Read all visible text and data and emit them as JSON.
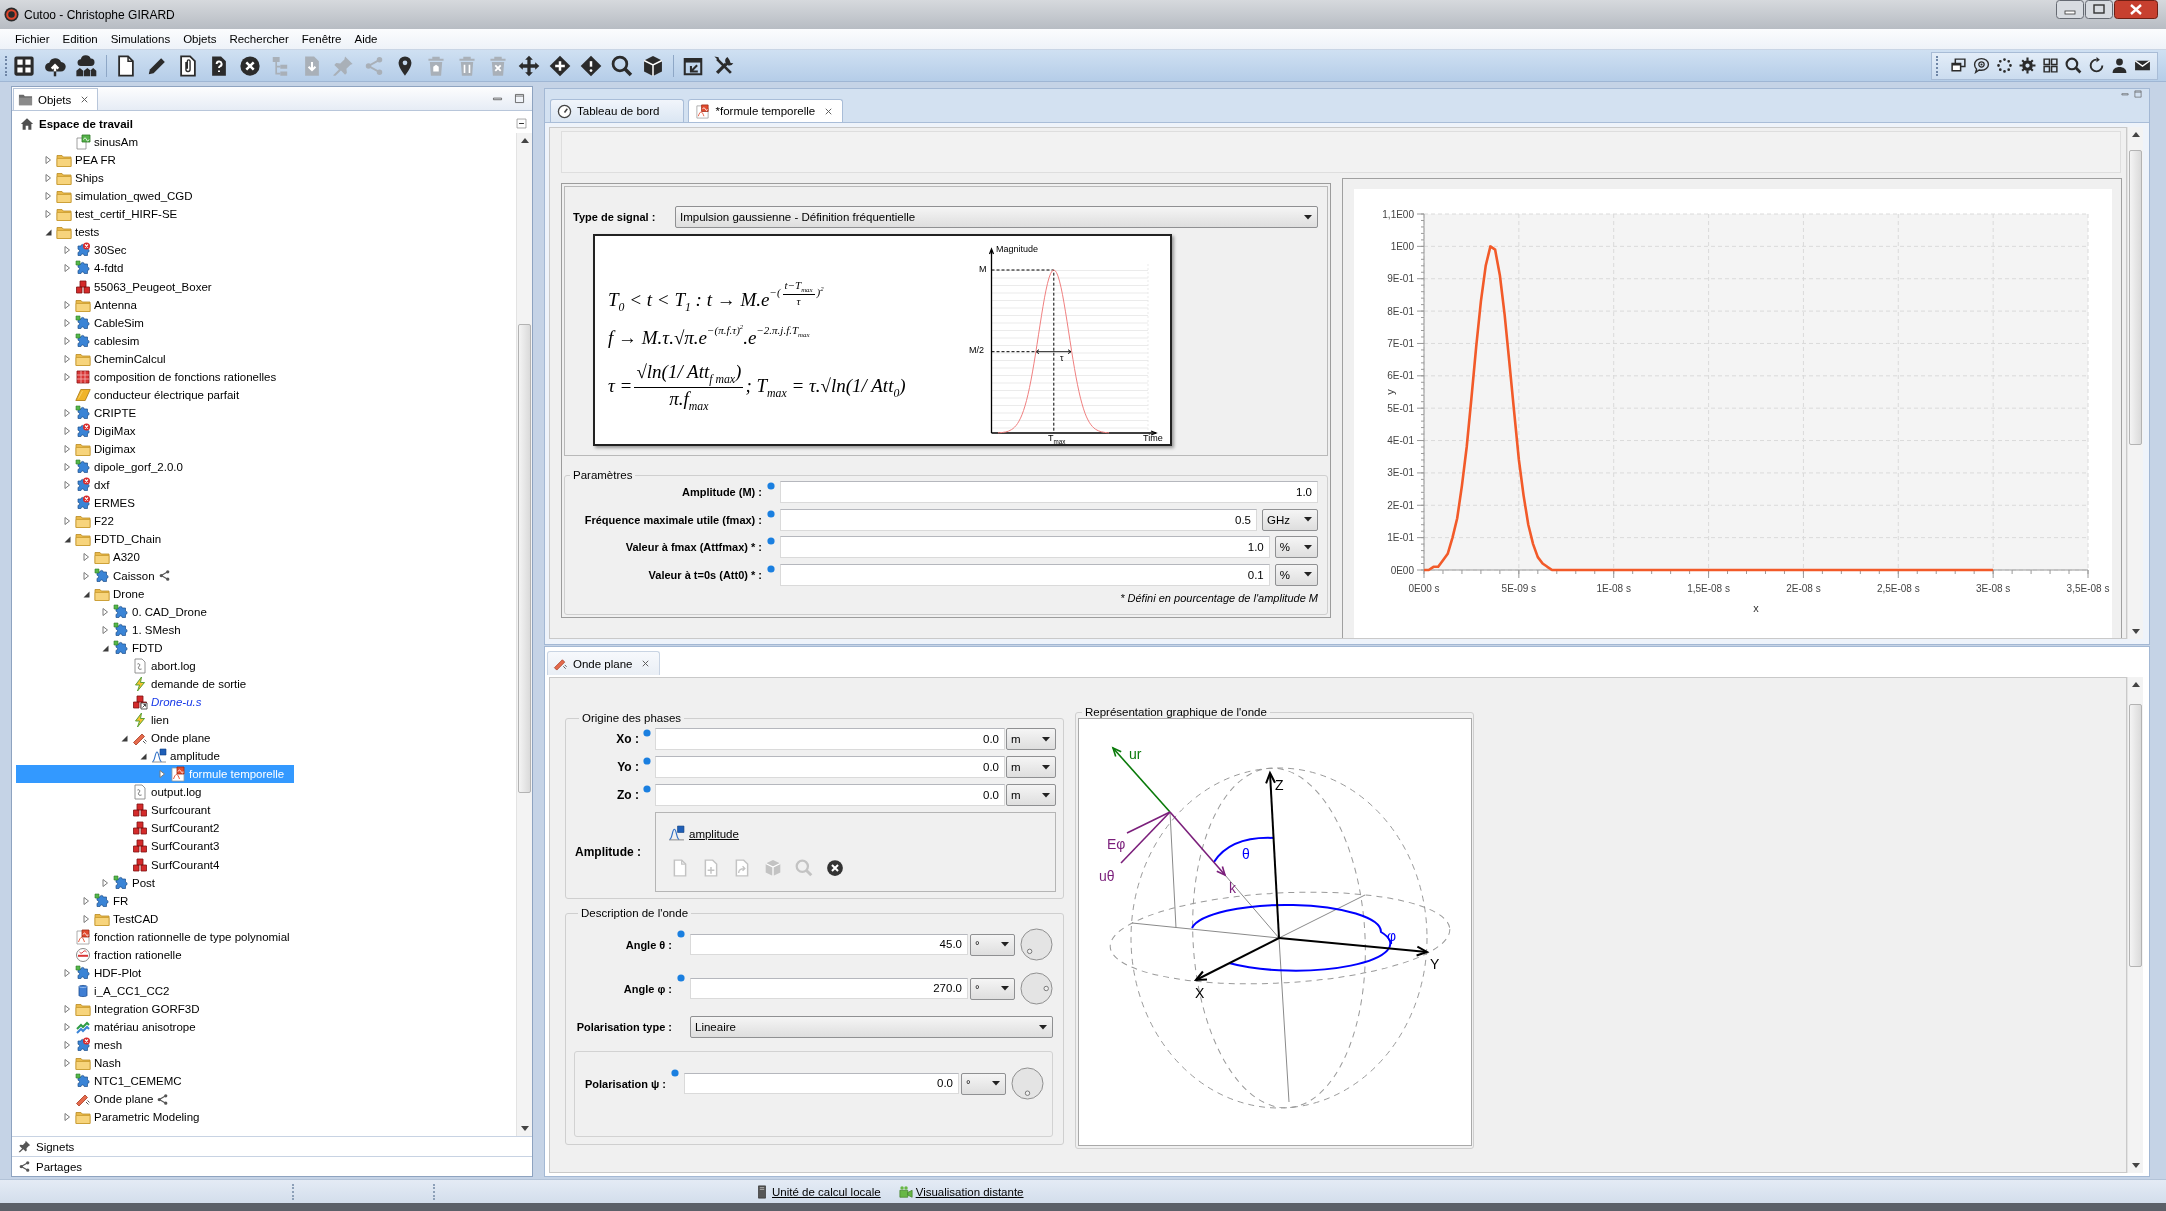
{
  "window": {
    "title": "Cutoo - Christophe GIRARD"
  },
  "menu": [
    "Fichier",
    "Edition",
    "Simulations",
    "Objets",
    "Rechercher",
    "Fenêtre",
    "Aide"
  ],
  "toolbar": {
    "groups": [
      [
        {
          "kind": "grid",
          "disabled": false
        },
        {
          "kind": "cloudup",
          "disabled": false
        },
        {
          "kind": "cloudhouse",
          "disabled": false
        }
      ],
      [
        {
          "kind": "doc",
          "disabled": false
        },
        {
          "kind": "pencil",
          "disabled": false
        },
        {
          "kind": "attach",
          "disabled": false
        },
        {
          "kind": "help",
          "disabled": false
        },
        {
          "kind": "closecircle",
          "disabled": false
        },
        {
          "kind": "tree",
          "disabled": true
        },
        {
          "kind": "import",
          "disabled": true
        },
        {
          "kind": "pin",
          "disabled": true
        },
        {
          "kind": "share",
          "disabled": true
        },
        {
          "kind": "marker",
          "disabled": false
        },
        {
          "kind": "trashbox",
          "disabled": true
        },
        {
          "kind": "trash",
          "disabled": true
        },
        {
          "kind": "trashx",
          "disabled": true
        },
        {
          "kind": "move",
          "disabled": false
        },
        {
          "kind": "plusdiamond",
          "disabled": false
        },
        {
          "kind": "tagdiamond",
          "disabled": false
        },
        {
          "kind": "search",
          "disabled": false
        },
        {
          "kind": "cube",
          "disabled": false
        }
      ],
      [
        {
          "kind": "winback",
          "disabled": false
        },
        {
          "kind": "tools",
          "disabled": false
        }
      ]
    ]
  },
  "objects": {
    "tab": "Objets",
    "root": "Espace de travail",
    "hidden_parent_children": [
      {
        "label": "sinusAm",
        "kind": "script",
        "selected": false
      }
    ],
    "items": [
      {
        "label": "PEA FR",
        "kind": "folder",
        "expanded": false,
        "selected": false
      },
      {
        "label": "Ships",
        "kind": "folder",
        "expanded": false,
        "selected": false
      },
      {
        "label": "simulation_qwed_CGD",
        "kind": "folder",
        "expanded": false,
        "selected": false
      },
      {
        "label": "test_certif_HIRF-SE",
        "kind": "folder",
        "expanded": false,
        "selected": false
      },
      {
        "label": "tests",
        "kind": "folder",
        "expanded": true,
        "selected": false,
        "children": [
          {
            "label": "30Sec",
            "kind": "simerror",
            "expanded": false,
            "selected": false
          },
          {
            "label": "4-fdtd",
            "kind": "sim",
            "expanded": false,
            "selected": false
          },
          {
            "label": "55063_Peugeot_Boxer",
            "kind": "part",
            "selected": false
          },
          {
            "label": "Antenna",
            "kind": "folder",
            "expanded": false,
            "selected": false
          },
          {
            "label": "CableSim",
            "kind": "sim",
            "expanded": false,
            "selected": false
          },
          {
            "label": "cablesim",
            "kind": "sim",
            "expanded": false,
            "selected": false
          },
          {
            "label": "CheminCalcul",
            "kind": "folder",
            "expanded": false,
            "selected": false
          },
          {
            "label": "composition de fonctions rationelles",
            "kind": "table",
            "expanded": false,
            "selected": false
          },
          {
            "label": "conducteur électrique parfait",
            "kind": "plate",
            "selected": false
          },
          {
            "label": "CRIPTE",
            "kind": "sim",
            "expanded": false,
            "selected": false
          },
          {
            "label": "DigiMax",
            "kind": "simerror",
            "expanded": false,
            "selected": false
          },
          {
            "label": "Digimax",
            "kind": "folder",
            "expanded": false,
            "selected": false
          },
          {
            "label": "dipole_gorf_2.0.0",
            "kind": "sim",
            "expanded": false,
            "selected": false
          },
          {
            "label": "dxf",
            "kind": "simerror",
            "expanded": false,
            "selected": false
          },
          {
            "label": "ERMES",
            "kind": "simerror",
            "selected": false
          },
          {
            "label": "F22",
            "kind": "folder",
            "expanded": false,
            "selected": false
          },
          {
            "label": "FDTD_Chain",
            "kind": "folder",
            "expanded": true,
            "selected": false,
            "children": [
              {
                "label": "A320",
                "kind": "folder",
                "expanded": false,
                "selected": false
              },
              {
                "label": "Caisson",
                "kind": "sim",
                "expanded": false,
                "selected": false,
                "shared": true
              },
              {
                "label": "Drone",
                "kind": "folder",
                "expanded": true,
                "selected": false,
                "children": [
                  {
                    "label": "0. CAD_Drone",
                    "kind": "sim",
                    "expanded": false,
                    "selected": false
                  },
                  {
                    "label": "1. SMesh",
                    "kind": "sim",
                    "expanded": false,
                    "selected": false
                  },
                  {
                    "label": "FDTD",
                    "kind": "sim",
                    "expanded": true,
                    "selected": false,
                    "children": [
                      {
                        "label": "abort.log",
                        "kind": "log",
                        "selected": false
                      },
                      {
                        "label": "demande de sortie",
                        "kind": "link",
                        "selected": false
                      },
                      {
                        "label": "Drone-u.s",
                        "kind": "partlink",
                        "selected": false
                      },
                      {
                        "label": "lien",
                        "kind": "link",
                        "selected": false
                      },
                      {
                        "label": "Onde plane",
                        "kind": "wave",
                        "expanded": true,
                        "selected": false,
                        "children": [
                          {
                            "label": "amplitude",
                            "kind": "signal",
                            "expanded": true,
                            "selected": false,
                            "children": [
                              {
                                "label": "formule temporelle",
                                "kind": "formula",
                                "expanded": false,
                                "selected": true
                              }
                            ]
                          }
                        ]
                      },
                      {
                        "label": "output.log",
                        "kind": "log",
                        "selected": false
                      },
                      {
                        "label": "Surfcourant",
                        "kind": "part",
                        "selected": false
                      },
                      {
                        "label": "SurfCourant2",
                        "kind": "part",
                        "selected": false
                      },
                      {
                        "label": "SurfCourant3",
                        "kind": "part",
                        "selected": false
                      },
                      {
                        "label": "SurfCourant4",
                        "kind": "part",
                        "selected": false
                      }
                    ]
                  },
                  {
                    "label": "Post",
                    "kind": "sim",
                    "expanded": false,
                    "selected": false
                  }
                ]
              },
              {
                "label": "FR",
                "kind": "sim",
                "expanded": false,
                "selected": false
              },
              {
                "label": "TestCAD",
                "kind": "folder",
                "expanded": false,
                "selected": false
              }
            ]
          },
          {
            "label": "fonction rationnelle de type polynomial",
            "kind": "formula",
            "selected": false
          },
          {
            "label": "fraction rationelle",
            "kind": "fraction",
            "selected": false
          },
          {
            "label": "HDF-Plot",
            "kind": "sim",
            "expanded": false,
            "selected": false
          },
          {
            "label": "i_A_CC1_CC2",
            "kind": "cylinder",
            "selected": false
          },
          {
            "label": "Integration GORF3D",
            "kind": "folder",
            "expanded": false,
            "selected": false
          },
          {
            "label": "matériau anisotrope",
            "kind": "material",
            "expanded": false,
            "selected": false
          },
          {
            "label": "mesh",
            "kind": "simerror",
            "expanded": false,
            "selected": false
          },
          {
            "label": "Nash",
            "kind": "folder",
            "expanded": false,
            "selected": false
          },
          {
            "label": "NTC1_CEMEMC",
            "kind": "sim",
            "selected": false
          },
          {
            "label": "Onde plane",
            "kind": "wave",
            "selected": false,
            "shared": true
          },
          {
            "label": "Parametric Modeling",
            "kind": "folder",
            "expanded": false,
            "selected": false
          }
        ]
      }
    ],
    "views": [
      {
        "label": "Signets",
        "kind": "pin"
      },
      {
        "label": "Partages",
        "kind": "share"
      }
    ]
  },
  "editor": {
    "tabs": [
      {
        "label": "Tableau de bord",
        "kind": "gauge",
        "selected": false
      },
      {
        "label": "*formule temporelle",
        "kind": "formula",
        "selected": true
      }
    ],
    "signal_type": {
      "label": "Type de signal :",
      "value": "Impulsion gaussienne - Définition fréquentielle"
    },
    "formula": {
      "equations": [
        {
          "parts": [
            {
              "kind": "text",
              "text": "T$_{0}$ < t < T$_{1}$ : t → M.e"
            },
            {
              "kind": "sup",
              "parts": [
                {
                  "kind": "text",
                  "text": "−("
                },
                {
                  "kind": "frac",
                  "num": "t−T$_{max}$",
                  "den": "τ"
                },
                {
                  "kind": "text",
                  "text": ")$^{2}$"
                }
              ]
            }
          ]
        },
        {
          "parts": [
            {
              "kind": "text",
              "text": "f → M.τ.√π.e"
            },
            {
              "kind": "sup",
              "parts": [
                {
                  "kind": "text",
                  "text": "−(π.f.τ)$^{2}$"
                }
              ]
            },
            {
              "kind": "text",
              "text": ".e"
            },
            {
              "kind": "sup",
              "parts": [
                {
                  "kind": "text",
                  "text": "−2.π.j.f.T$_{max}$"
                }
              ]
            }
          ]
        },
        {
          "parts": [
            {
              "kind": "text",
              "text": "τ ="
            },
            {
              "kind": "frac",
              "num": "√ln(1/ Att$_{f max}$)",
              "den": "π.f$_{max}$"
            },
            {
              "kind": "text",
              "text": "; T$_{max}$ = τ.√ln(1/ Att$_{0}$)"
            }
          ]
        }
      ],
      "plot": {
        "y_axis": "Magnitude",
        "peak": "M",
        "half": "M/2",
        "width": "τ",
        "peak_time": "T$_{max}$",
        "x_axis": "Time"
      }
    },
    "parameters": {
      "title": "Paramètres",
      "rows": [
        {
          "label": "Amplitude (M) :",
          "value": "1.0"
        },
        {
          "label": "Fréquence maximale utile (fmax) :",
          "value": "0.5",
          "unit": "GHz"
        },
        {
          "label": "Valeur à fmax (Attfmax) * :",
          "value": "1.0",
          "unit": "%"
        },
        {
          "label": "Valeur à t=0s (Att0) * :",
          "value": "0.1",
          "unit": "%"
        }
      ],
      "footnote": "* Défini en pourcentage de l'amplitude M"
    },
    "chart": {
      "chart_data": {
        "type": "line",
        "xlabel": "x",
        "ylabel": "y",
        "grid": true,
        "categories": [
          "0E00 s",
          null,
          null,
          null,
          null,
          null,
          null,
          null,
          null,
          null,
          null,
          null,
          null,
          null,
          null,
          null,
          null,
          null,
          null,
          null,
          "5E-09 s",
          null,
          null,
          null,
          null,
          null,
          null,
          null,
          null,
          null,
          null,
          null,
          null,
          null,
          null,
          null,
          null,
          null,
          null,
          null,
          "1E-08 s",
          null,
          null,
          null,
          null,
          null,
          null,
          null,
          null,
          null,
          null,
          null,
          null,
          null,
          null,
          null,
          null,
          null,
          null,
          null,
          "1,5E-08 s",
          null,
          null,
          null,
          null,
          null,
          null,
          null,
          null,
          null,
          null,
          null,
          null,
          null,
          null,
          null,
          null,
          null,
          null,
          null,
          "2E-08 s",
          null,
          null,
          null,
          null,
          null,
          null,
          null,
          null,
          null,
          null,
          null,
          null,
          null,
          null,
          null,
          null,
          null,
          null,
          null,
          "2,5E-08 s",
          null,
          null,
          null,
          null,
          null,
          null,
          null,
          null,
          null,
          null,
          null,
          null,
          null,
          null,
          null,
          null,
          null,
          null,
          null,
          "3E-08 s",
          null,
          null,
          null,
          null,
          null,
          null,
          null,
          null,
          null,
          null,
          null,
          null,
          null,
          null,
          null,
          null,
          null,
          null,
          null,
          "3,5E-08 s"
        ],
        "values": [
          0,
          0,
          0.01,
          0.01,
          0.03,
          0.05,
          0.1,
          0.16,
          0.26,
          0.38,
          0.53,
          0.69,
          0.83,
          0.94,
          1.0,
          0.99,
          0.91,
          0.79,
          0.64,
          0.49,
          0.34,
          0.23,
          0.14,
          0.08,
          0.04,
          0.02,
          0.01,
          0,
          0,
          0,
          0,
          0,
          0,
          0,
          0,
          0,
          0,
          0,
          0,
          0,
          0,
          0,
          0,
          0,
          0,
          0,
          0,
          0,
          0,
          0,
          0,
          0,
          0,
          0,
          0,
          0,
          0,
          0,
          0,
          0,
          0,
          0,
          0,
          0,
          0,
          0,
          0,
          0,
          0,
          0,
          0,
          0,
          0,
          0,
          0,
          0,
          0,
          0,
          0,
          0,
          0,
          0,
          0,
          0,
          0,
          0,
          0,
          0,
          0,
          0,
          0,
          0,
          0,
          0,
          0,
          0,
          0,
          0,
          0,
          0,
          0,
          0,
          0,
          0,
          0,
          0,
          0,
          0,
          0,
          0,
          0,
          0,
          0,
          0,
          0,
          0,
          0,
          0,
          0,
          0,
          0,
          null,
          null,
          null,
          null,
          null,
          null,
          null,
          null,
          null,
          null,
          null,
          null,
          null,
          null,
          null,
          null,
          null,
          null,
          null,
          null
        ],
        "ylim": [
          0,
          1.1
        ],
        "yticks": [
          {
            "value": 0,
            "label": "0E00"
          },
          {
            "value": 0.1,
            "label": "1E-01"
          },
          {
            "value": 0.2,
            "label": "2E-01"
          },
          {
            "value": 0.3,
            "label": "3E-01"
          },
          {
            "value": 0.4,
            "label": "4E-01"
          },
          {
            "value": 0.5,
            "label": "5E-01"
          },
          {
            "value": 0.6,
            "label": "6E-01"
          },
          {
            "value": 0.7,
            "label": "7E-01"
          },
          {
            "value": 0.8,
            "label": "8E-01"
          },
          {
            "value": 0.9,
            "label": "9E-01"
          },
          {
            "value": 1,
            "label": "1E00"
          },
          {
            "value": 1.1,
            "label": "1,1E00"
          }
        ]
      }
    }
  },
  "wave": {
    "tab": "Onde plane",
    "phase_origin": {
      "title": "Origine des phases",
      "rows": [
        {
          "label": "Xo :",
          "value": "0.0",
          "unit": "m"
        },
        {
          "label": "Yo :",
          "value": "0.0",
          "unit": "m"
        },
        {
          "label": "Zo :",
          "value": "0.0",
          "unit": "m"
        }
      ]
    },
    "amplitude": {
      "label": "Amplitude :",
      "link": "amplitude",
      "actions": [
        {
          "kind": "doc",
          "disabled": true
        },
        {
          "kind": "docplus",
          "disabled": true
        },
        {
          "kind": "docarrow",
          "disabled": true
        },
        {
          "kind": "cube",
          "disabled": true
        },
        {
          "kind": "search",
          "disabled": true
        },
        {
          "kind": "closecircle",
          "disabled": false
        }
      ]
    },
    "description": {
      "title": "Description de l'onde",
      "rows": [
        {
          "kind": "angle",
          "label": "Angle θ :",
          "value": "45.0",
          "unit": "°"
        },
        {
          "kind": "angle",
          "label": "Angle φ :",
          "value": "270.0",
          "unit": "°"
        },
        {
          "kind": "choice",
          "label": "Polarisation type :",
          "value": "Lineaire"
        }
      ],
      "polarisation": {
        "label": "Polarisation ψ :",
        "value": "0.0",
        "unit": "°"
      }
    },
    "graphic": {
      "title": "Représentation graphique de l'onde",
      "labels": {
        "z": "Z",
        "y": "Y",
        "x": "X",
        "theta": "θ",
        "phi": "φ",
        "k": "k",
        "ur": "ur",
        "e_phi": "Eφ",
        "u_theta": "uθ"
      }
    }
  },
  "status_bar": {
    "links": [
      {
        "label": "Unité de calcul locale",
        "kind": "server"
      },
      {
        "label": "Visualisation distante",
        "kind": "camera"
      }
    ]
  }
}
